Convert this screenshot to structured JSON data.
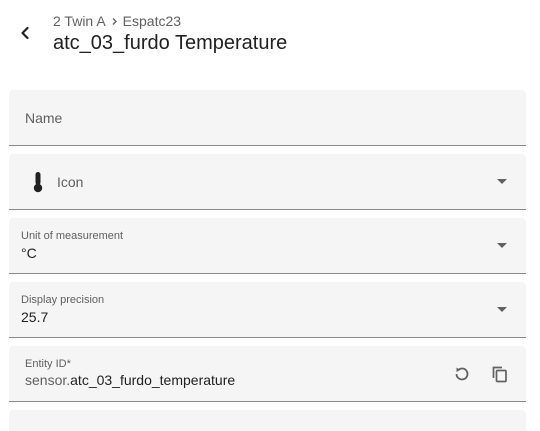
{
  "header": {
    "breadcrumb": [
      "2 Twin A",
      "Espatc23"
    ],
    "title": "atc_03_furdo Temperature"
  },
  "fields": {
    "name": {
      "label": "Name"
    },
    "icon": {
      "label": "Icon",
      "icon": "thermometer-icon"
    },
    "unit": {
      "label": "Unit of measurement",
      "value": "°C"
    },
    "precision": {
      "label": "Display precision",
      "value": "25.7"
    },
    "entity_id": {
      "label": "Entity ID*",
      "prefix": "sensor.",
      "value": "atc_03_furdo_temperature"
    }
  },
  "colors": {
    "field_bg": "#f5f5f5",
    "text": "#212121",
    "secondary": "#5f5f5f"
  }
}
